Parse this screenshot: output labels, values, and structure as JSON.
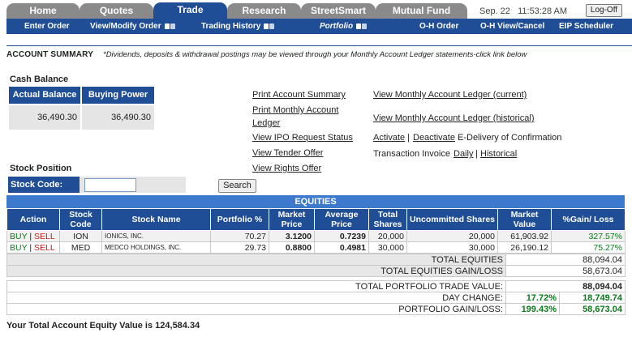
{
  "tabs": [
    "Home",
    "Quotes",
    "Trade",
    "Research",
    "StreetSmart",
    "Mutual Fund"
  ],
  "datetime": "Sep. 22   11:53:28 AM",
  "logoff_label": "Log-Off",
  "subnav": [
    "Enter Order",
    "View/Modify Order",
    "Trading History",
    "Portfolio",
    "O-H Order",
    "O-H View/Cancel",
    "EIP Scheduler"
  ],
  "account_summary": {
    "title": "ACCOUNT SUMMARY",
    "note": "*Dividends, deposits & withdrawal postings may be viewed through your Monthly Account Ledger statements-click link below"
  },
  "cash": {
    "section_label": "Cash Balance",
    "actual_label": "Actual Balance",
    "buying_label": "Buying Power",
    "actual_value": "36,490.30",
    "buying_value": "36,490.30"
  },
  "links": {
    "print_summary": "Print Account Summary",
    "print_ledger_1": "Print Monthly Account",
    "print_ledger_2": "Ledger",
    "ipo": "View IPO Request Status",
    "tender": "View Tender Offer",
    "rights": "View Rights Offer",
    "ledger_current": "View Monthly Account Ledger (current)",
    "ledger_historical": "View Monthly Account Ledger (historical)",
    "activate": "Activate",
    "deactivate": "Deactivate",
    "edelivery": "E-Delivery of Confirmation",
    "invoice_label": "Transaction Invoice",
    "daily": "Daily",
    "historical": "Historical",
    "pipe": "|"
  },
  "stock_position": {
    "section_label": "Stock Position",
    "code_label": "Stock Code:",
    "code_value": "",
    "search_label": "Search"
  },
  "equities": {
    "banner": "EQUITIES",
    "headers": [
      "Action",
      "Stock Code",
      "Stock Name",
      "Portfolio %",
      "Market Price",
      "Average Price",
      "Total Shares",
      "Uncommitted Shares",
      "Market Value",
      "%Gain/ Loss"
    ],
    "buy_label": "BUY",
    "sell_label": "SELL",
    "rows": [
      {
        "code": "ION",
        "name": "IONICS, INC.",
        "portfolio": "70.27",
        "market_price": "3.1200",
        "avg_price": "0.7239",
        "total_shares": "20,000",
        "uncommitted": "20,000",
        "market_value": "61,903.92",
        "gain": "327.57%"
      },
      {
        "code": "MED",
        "name": "MEDCO HOLDINGS, INC.",
        "portfolio": "29.73",
        "market_price": "0.8800",
        "avg_price": "0.4981",
        "total_shares": "30,000",
        "uncommitted": "30,000",
        "market_value": "26,190.12",
        "gain": "75.27%"
      }
    ],
    "total_equities_label": "TOTAL EQUITIES",
    "total_equities_value": "88,094.04",
    "total_gain_label": "TOTAL EQUITIES GAIN/LOSS",
    "total_gain_value": "58,673.04"
  },
  "portfolio": {
    "trade_value_label": "TOTAL PORTFOLIO TRADE VALUE:",
    "trade_value": "88,094.04",
    "day_change_label": "DAY CHANGE:",
    "day_change_pct": "17.72%",
    "day_change_value": "18,749.74",
    "gain_label": "PORTFOLIO GAIN/LOSS:",
    "gain_pct": "199.43%",
    "gain_value": "58,673.04"
  },
  "final_text": "Your Total Account Equity Value is 124,584.34",
  "colors": {
    "primary": "#1f4e96",
    "banner": "#3d79cc",
    "tab_inactive": "#8a8a8a",
    "green": "#0a7a1a",
    "red": "#c01b1b"
  }
}
